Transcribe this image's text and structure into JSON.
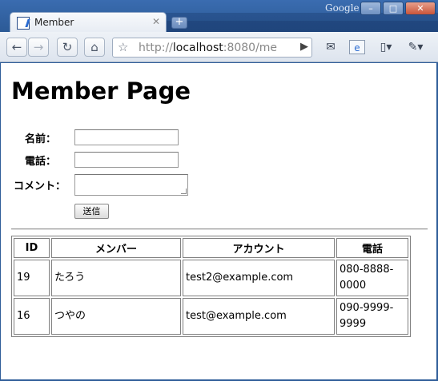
{
  "window": {
    "tab_title": "Member",
    "google_label": "Google"
  },
  "toolbar": {
    "url_scheme": "http://",
    "url_host": "localhost",
    "url_rest": ":8080/me"
  },
  "page": {
    "heading": "Member Page",
    "form": {
      "name_label": "名前：",
      "phone_label": "電話：",
      "comment_label": "コメント：",
      "name_value": "",
      "phone_value": "",
      "comment_value": "",
      "submit_label": "送信"
    },
    "table": {
      "headers": [
        "ID",
        "メンバー",
        "アカウント",
        "電話"
      ],
      "rows": [
        {
          "id": "19",
          "member": "たろう",
          "account": "test2@example.com",
          "phone": "080-8888-0000"
        },
        {
          "id": "16",
          "member": "つやの",
          "account": "test@example.com",
          "phone": "090-9999-9999"
        }
      ]
    }
  },
  "colors": {
    "frame_blue": "#2f5d99",
    "text": "#000000"
  }
}
